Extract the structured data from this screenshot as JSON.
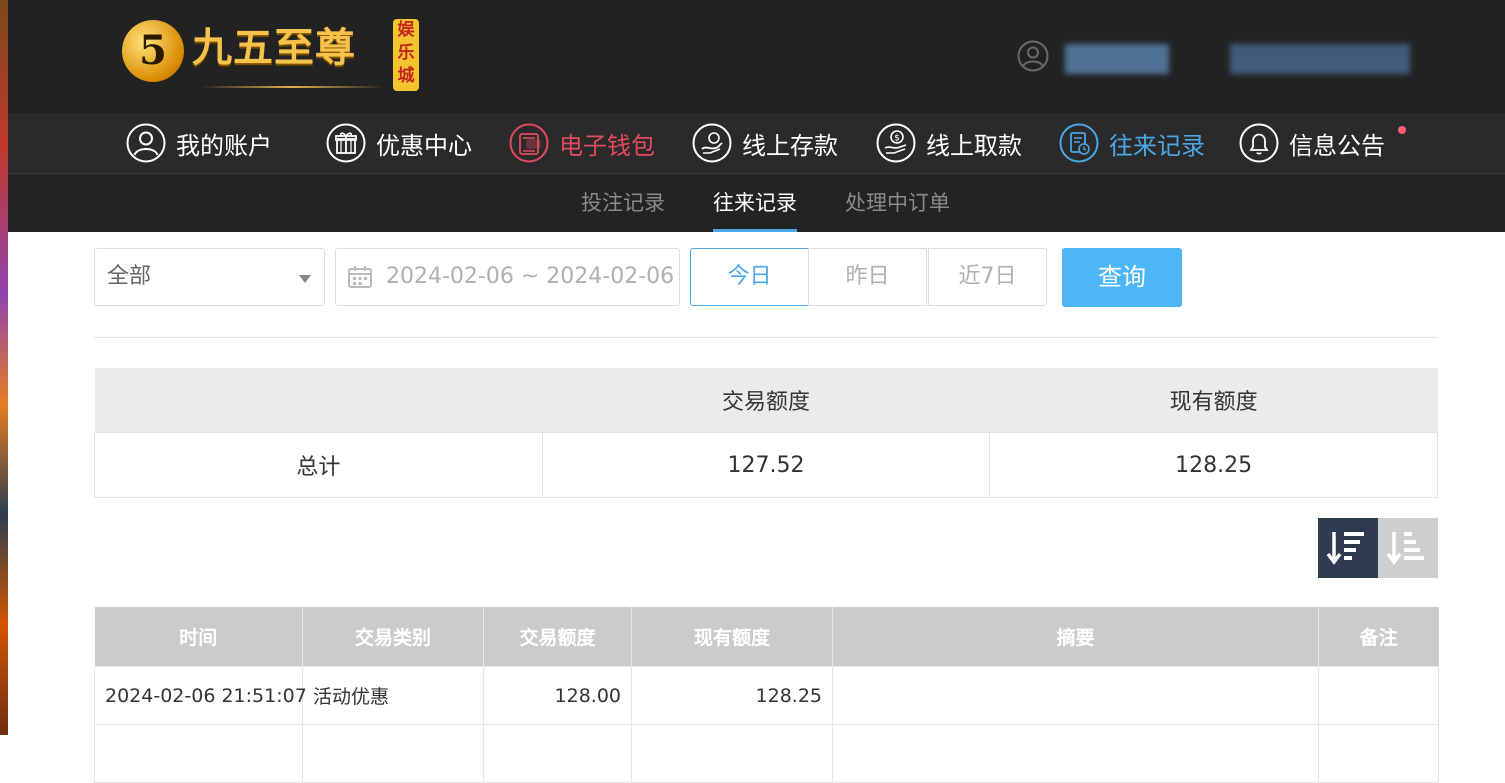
{
  "brand": {
    "logo_digit": "5",
    "logo_text": "九五至尊",
    "badge_text": "娱乐城"
  },
  "main_nav": [
    {
      "label": "我的账户",
      "icon": "user-icon"
    },
    {
      "label": "优惠中心",
      "icon": "gift-icon"
    },
    {
      "label": "电子钱包",
      "icon": "wallet-icon"
    },
    {
      "label": "线上存款",
      "icon": "deposit-icon"
    },
    {
      "label": "线上取款",
      "icon": "withdraw-icon"
    },
    {
      "label": "往来记录",
      "icon": "records-icon"
    },
    {
      "label": "信息公告",
      "icon": "bell-icon"
    }
  ],
  "sub_nav": [
    "投注记录",
    "往来记录",
    "处理中订单"
  ],
  "filters": {
    "type_select": "全部",
    "date_range": "2024-02-06 ~ 2024-02-06",
    "quick_ranges": [
      "今日",
      "昨日",
      "近7日"
    ],
    "query_label": "查询"
  },
  "summary": {
    "headers": [
      "",
      "交易额度",
      "现有额度"
    ],
    "row": [
      "总计",
      "127.52",
      "128.25"
    ]
  },
  "records": {
    "headers": [
      "时间",
      "交易类别",
      "交易额度",
      "现有额度",
      "摘要",
      "备注"
    ],
    "rows": [
      [
        "2024-02-06 21:51:07",
        "活动优惠",
        "128.00",
        "128.25",
        "",
        ""
      ]
    ]
  },
  "colors": {
    "accent": "#4aa7e8",
    "wallet": "#e24a5e",
    "query_button": "#4db6f5",
    "header_bg": "#222222"
  }
}
